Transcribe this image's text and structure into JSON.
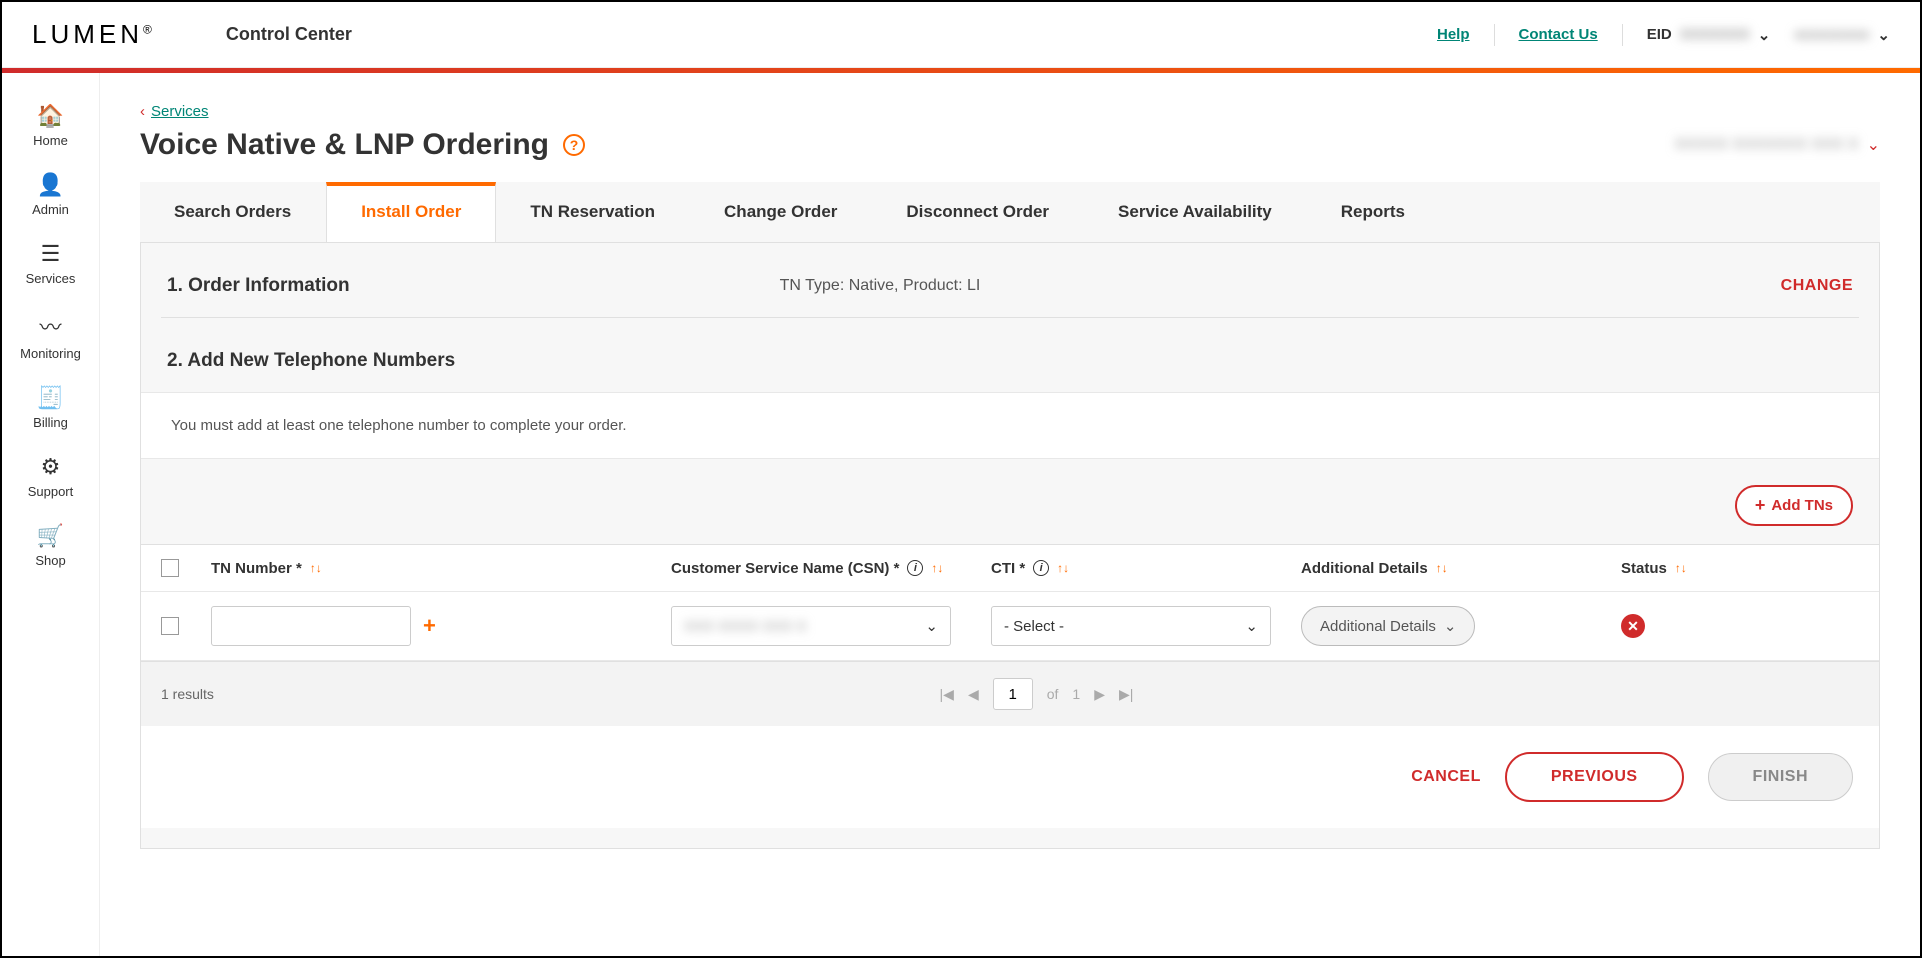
{
  "header": {
    "logo": "LUMEN",
    "app_title": "Control Center",
    "help": "Help",
    "contact": "Contact Us",
    "eid_label": "EID",
    "eid_value": "XXXXXXX",
    "user_value": "xxxxxxxxx"
  },
  "nav": [
    {
      "icon": "🏠",
      "label": "Home"
    },
    {
      "icon": "👤",
      "label": "Admin"
    },
    {
      "icon": "☰",
      "label": "Services"
    },
    {
      "icon": "〰",
      "label": "Monitoring"
    },
    {
      "icon": "🧾",
      "label": "Billing"
    },
    {
      "icon": "⚙",
      "label": "Support"
    },
    {
      "icon": "🛒",
      "label": "Shop"
    }
  ],
  "breadcrumb": {
    "label": "Services"
  },
  "page_title": "Voice Native & LNP Ordering",
  "account_dropdown": "XXXXX XXXXXXX XXX X",
  "tabs": [
    {
      "label": "Search Orders"
    },
    {
      "label": "Install Order",
      "active": true
    },
    {
      "label": "TN Reservation"
    },
    {
      "label": "Change Order"
    },
    {
      "label": "Disconnect Order"
    },
    {
      "label": "Service Availability"
    },
    {
      "label": "Reports"
    }
  ],
  "step1": {
    "label": "1. Order Information",
    "meta": "TN Type: Native, Product: LI",
    "change": "CHANGE"
  },
  "step2": {
    "label": "2. Add New Telephone Numbers",
    "info": "You must add at least one telephone number to complete your order.",
    "add_btn": "Add TNs",
    "columns": {
      "tn": "TN Number *",
      "csn": "Customer Service Name (CSN) *",
      "cti": "CTI *",
      "details": "Additional Details",
      "status": "Status"
    },
    "row": {
      "tn_value": "",
      "csn_value": "XXX XXXX XXX X",
      "cti_placeholder": "- Select -",
      "details_btn": "Additional Details"
    },
    "pager": {
      "results": "1 results",
      "page": "1",
      "of": "of",
      "total": "1"
    },
    "footer": {
      "cancel": "CANCEL",
      "previous": "PREVIOUS",
      "finish": "FINISH"
    }
  }
}
